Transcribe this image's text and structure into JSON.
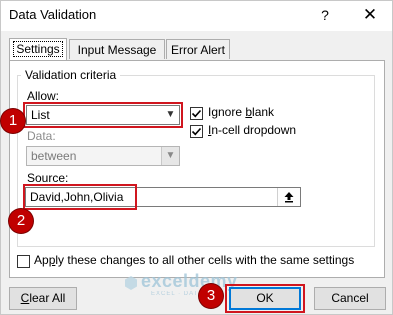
{
  "window": {
    "title": "Data Validation",
    "help_label": "?",
    "close_label": "✕"
  },
  "tabs": [
    {
      "label": "Settings",
      "active": true
    },
    {
      "label": "Input Message",
      "active": false
    },
    {
      "label": "Error Alert",
      "active": false
    }
  ],
  "criteria": {
    "group_label": "Validation criteria",
    "allow_label": "Allow:",
    "allow_value": "List",
    "data_label": "Data:",
    "data_value": "between",
    "source_label": "Source:",
    "source_value": "David,John,Olivia",
    "ignore_blank": {
      "label_prefix": "Ignore ",
      "label_underline": "b",
      "label_suffix": "lank",
      "checked": true
    },
    "in_cell_dropdown": {
      "label_prefix": "",
      "label_underline": "I",
      "label_suffix": "n-cell dropdown",
      "checked": true
    }
  },
  "apply_all": {
    "label_prefix": "Ap",
    "label_underline": "p",
    "label_suffix": "ly these changes to all other cells with the same settings",
    "checked": false
  },
  "buttons": {
    "clear_all_prefix": "",
    "clear_all_underline": "C",
    "clear_all_suffix": "lear All",
    "ok": "OK",
    "cancel": "Cancel"
  },
  "annotations": {
    "step1": "1",
    "step2": "2",
    "step3": "3",
    "accent_color": "#c00000"
  },
  "watermark": {
    "name": "exceldemy",
    "tagline": "EXCEL · DATA · BI"
  }
}
